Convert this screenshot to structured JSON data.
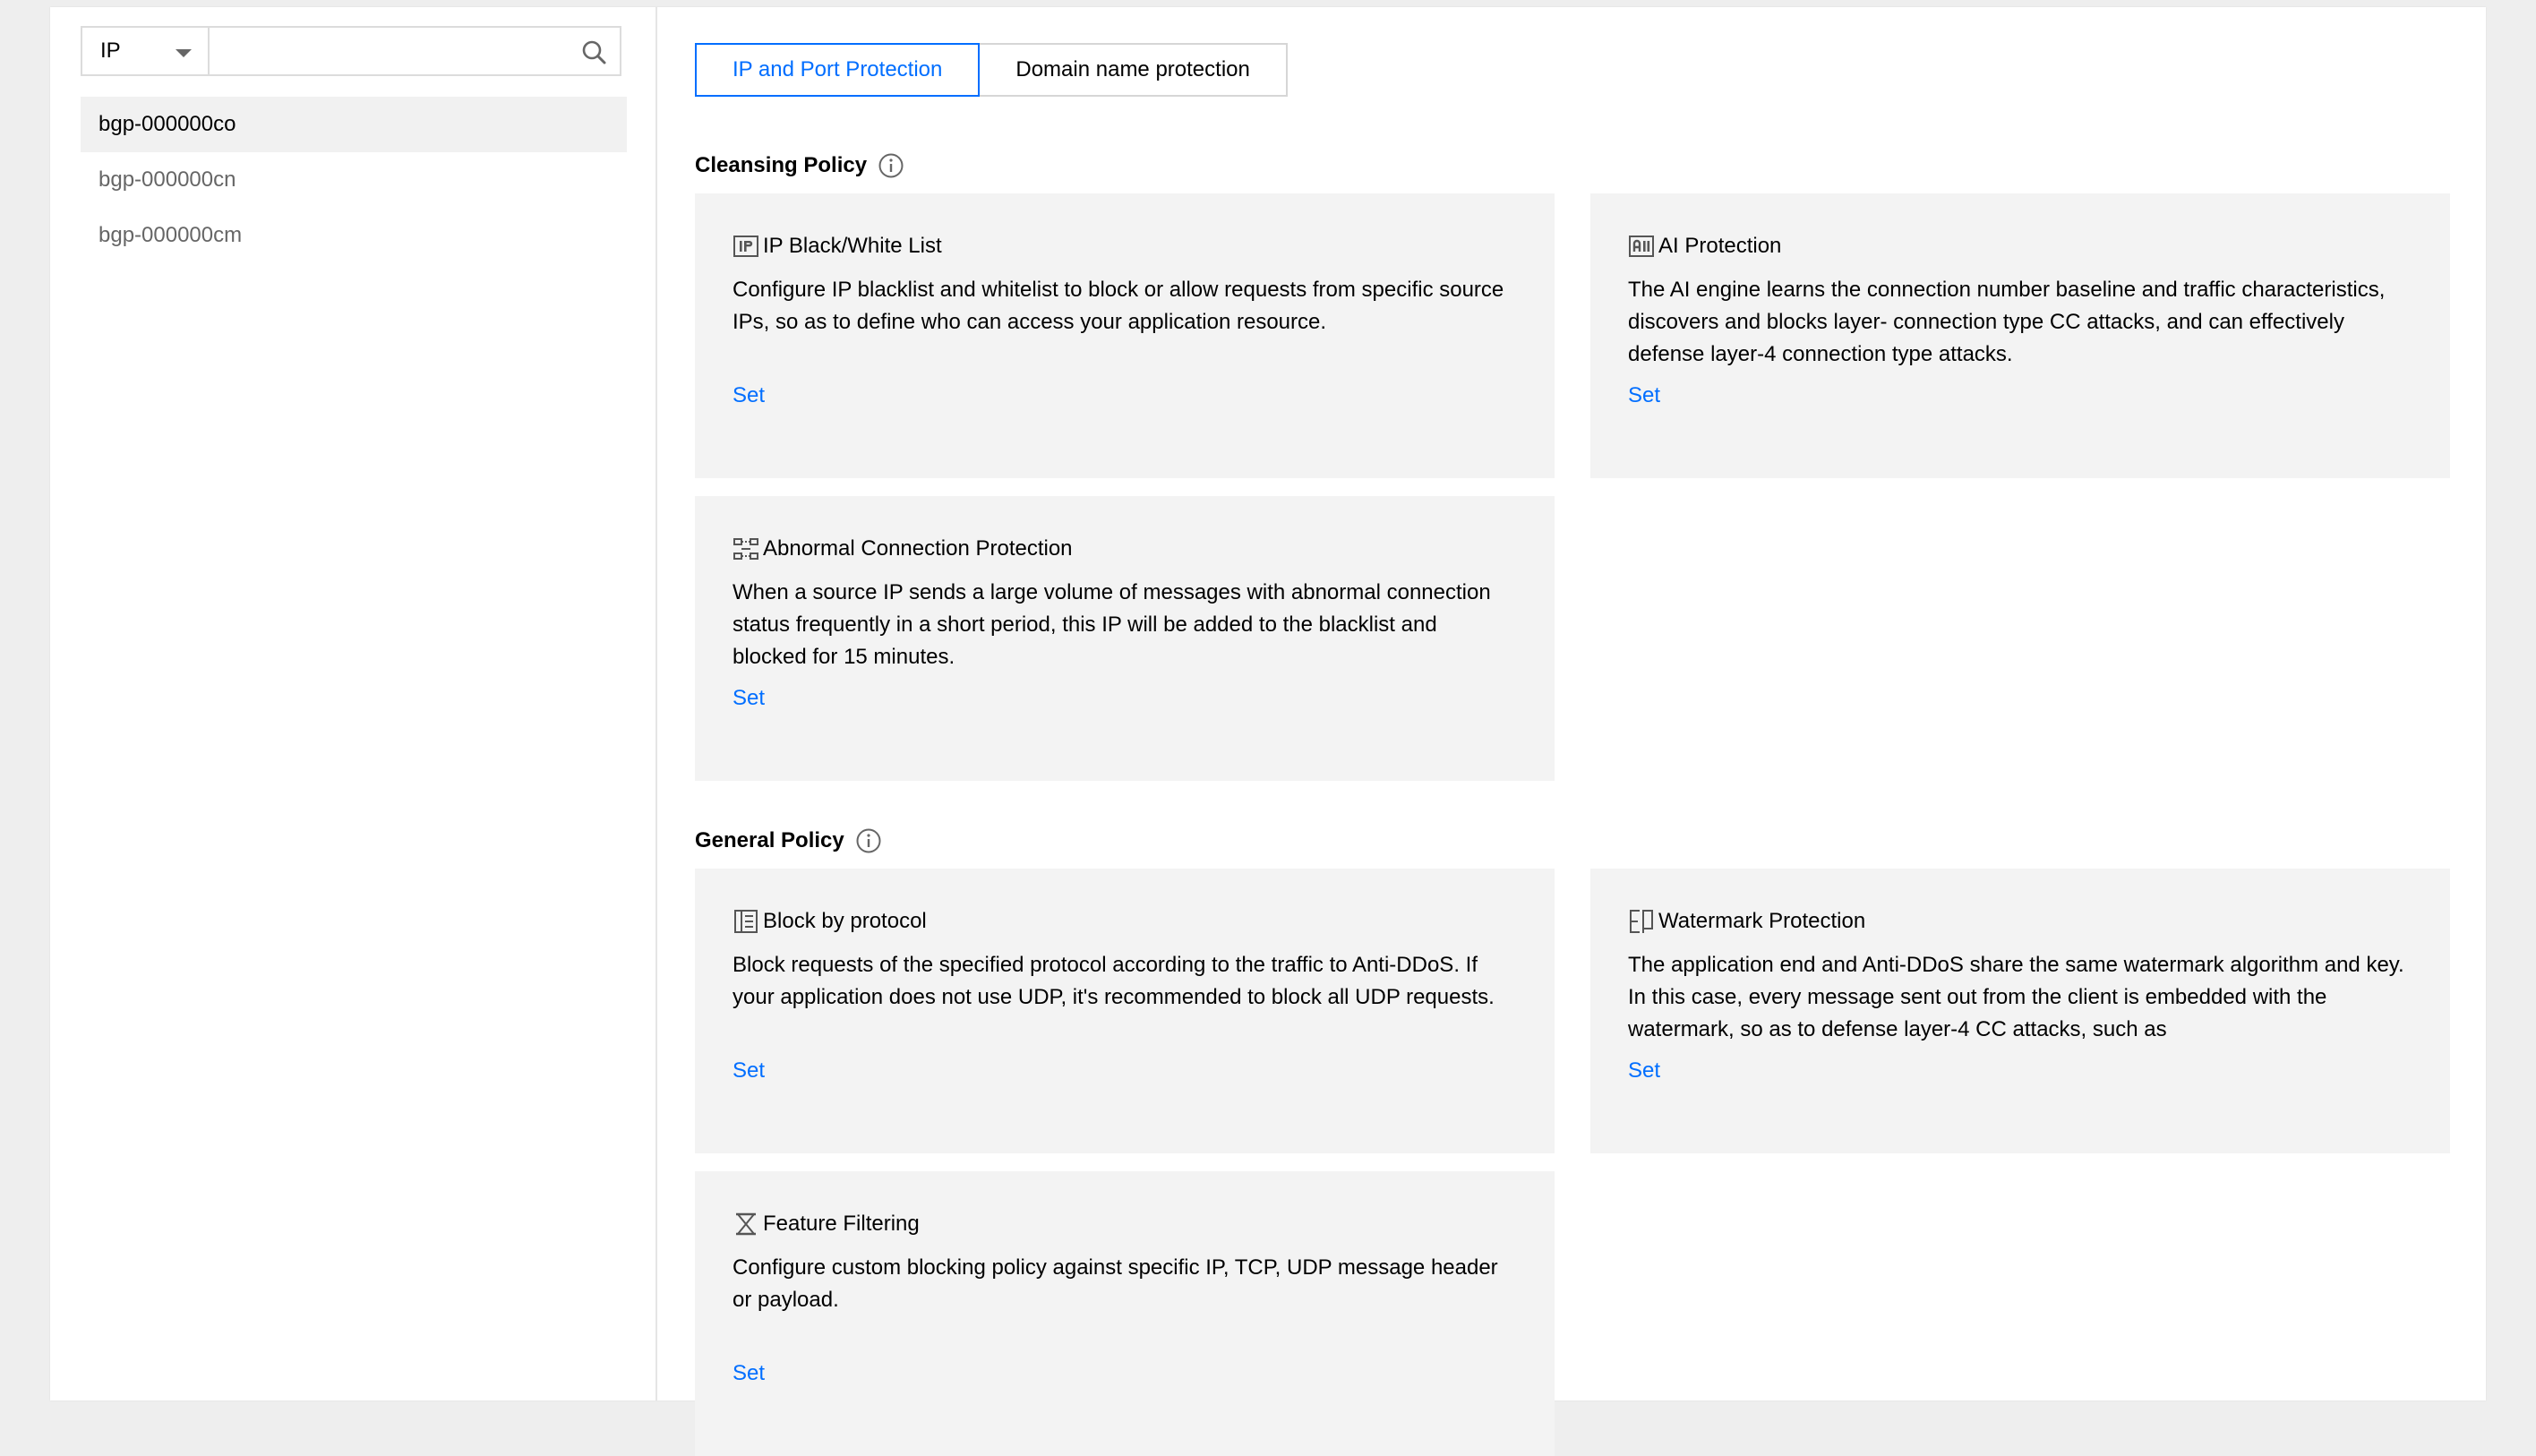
{
  "sidebar": {
    "filter_type": "IP",
    "search_value": "",
    "search_placeholder": "",
    "instances": [
      {
        "id": "bgp-000000co",
        "active": true
      },
      {
        "id": "bgp-000000cn",
        "active": false
      },
      {
        "id": "bgp-000000cm",
        "active": false
      }
    ]
  },
  "tabs": [
    {
      "label": "IP and Port Protection",
      "active": true
    },
    {
      "label": "Domain name protection",
      "active": false
    }
  ],
  "cleansing_policy": {
    "title": "Cleansing Policy",
    "cards": [
      {
        "icon": "ip-list-icon",
        "title": "IP Black/White List",
        "description": "Configure IP blacklist and whitelist to block or allow requests from specific source IPs, so as to define who can access your application resource.",
        "link": "Set"
      },
      {
        "icon": "ai-icon",
        "title": "AI Protection",
        "description": "The AI engine learns the connection number baseline and traffic characteristics, discovers and blocks layer- connection type CC attacks, and can effectively defense layer-4 connection type attacks.",
        "link": "Set"
      },
      {
        "icon": "connection-icon",
        "title": "Abnormal Connection Protection",
        "description": "When a source IP sends a large volume of messages with abnormal connection status frequently in a short period, this IP will be added to the blacklist and blocked for 15 minutes.",
        "link": "Set"
      }
    ]
  },
  "general_policy": {
    "title": "General Policy",
    "cards": [
      {
        "icon": "protocol-icon",
        "title": "Block by protocol",
        "description": "Block requests of the specified protocol according to the traffic to Anti-DDoS. If your application does not use UDP, it's recommended to block all UDP requests.",
        "link": "Set"
      },
      {
        "icon": "watermark-icon",
        "title": "Watermark Protection",
        "description": "The application end and Anti-DDoS share the same watermark algorithm and key. In this case, every message sent out from the client is embedded with the watermark, so as to defense layer-4 CC attacks, such as",
        "link": "Set"
      },
      {
        "icon": "filter-icon",
        "title": "Feature Filtering",
        "description": "Configure custom blocking policy against specific IP, TCP, UDP message header or payload.",
        "link": "Set"
      }
    ]
  },
  "colors": {
    "accent": "#006eff",
    "card_background": "#f3f3f3",
    "page_background": "#eeeeee"
  }
}
